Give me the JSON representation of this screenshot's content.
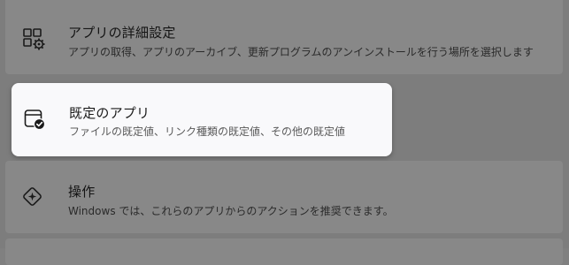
{
  "items": [
    {
      "icon": "apps-settings-icon",
      "title": "アプリの詳細設定",
      "description": "アプリの取得、アプリのアーカイブ、更新プログラムのアンインストールを行う場所を選択します"
    },
    {
      "icon": "default-apps-icon",
      "title": "既定のアプリ",
      "description": "ファイルの既定値、リンク種類の既定値、その他の既定値"
    },
    {
      "icon": "actions-icon",
      "title": "操作",
      "description": "Windows では、これらのアプリからのアクションを推奨できます。"
    }
  ]
}
